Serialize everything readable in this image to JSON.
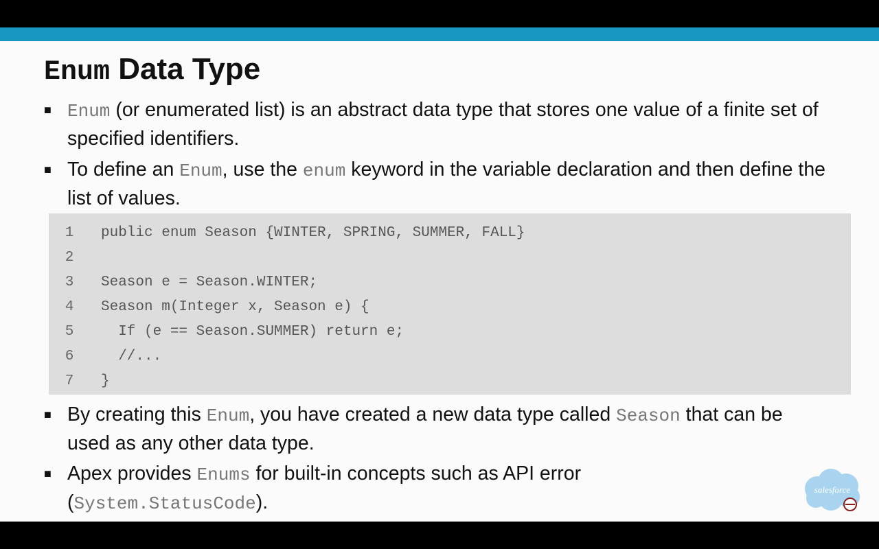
{
  "slide": {
    "title_code": "Enum",
    "title_rest": "Data Type",
    "bullets": [
      {
        "parts": [
          {
            "text": "Enum",
            "code": true
          },
          {
            "text": " (or enumerated list) is an abstract data type that stores one value of a finite set of specified identifiers.",
            "code": false
          }
        ]
      },
      {
        "parts": [
          {
            "text": "To define an ",
            "code": false
          },
          {
            "text": "Enum",
            "code": true
          },
          {
            "text": ", use the ",
            "code": false
          },
          {
            "text": "enum",
            "code": true
          },
          {
            "text": " keyword in the variable declaration and then define the list of values.",
            "code": false
          }
        ]
      },
      {
        "parts": [
          {
            "text": "By creating this ",
            "code": false
          },
          {
            "text": "Enum",
            "code": true
          },
          {
            "text": ", you have created a new data type called ",
            "code": false
          },
          {
            "text": "Season",
            "code": true
          },
          {
            "text": " that can be used as any other data type.",
            "code": false
          }
        ]
      },
      {
        "parts": [
          {
            "text": "Apex provides ",
            "code": false
          },
          {
            "text": "Enums",
            "code": true
          },
          {
            "text": " for built-in concepts such as API error (",
            "code": false
          },
          {
            "text": "System.StatusCode",
            "code": true
          },
          {
            "text": ").",
            "code": false
          }
        ]
      }
    ],
    "code_lines": [
      {
        "num": "1",
        "text": "public enum Season {WINTER, SPRING, SUMMER, FALL}"
      },
      {
        "num": "2",
        "text": ""
      },
      {
        "num": "3",
        "text": "Season e = Season.WINTER;"
      },
      {
        "num": "4",
        "text": "Season m(Integer x, Season e) {"
      },
      {
        "num": "5",
        "text": "  If (e == Season.SUMMER) return e;"
      },
      {
        "num": "6",
        "text": "  //..."
      },
      {
        "num": "7",
        "text": "}"
      }
    ],
    "logo": {
      "text": "salesforce",
      "icon": "salesforce-cloud-logo",
      "color": "#a9d4ef"
    }
  },
  "colors": {
    "accent_bar": "#1798c1",
    "slide_bg": "#fbfbfb",
    "code_bg": "#dddddd",
    "letterbox": "#000000"
  }
}
